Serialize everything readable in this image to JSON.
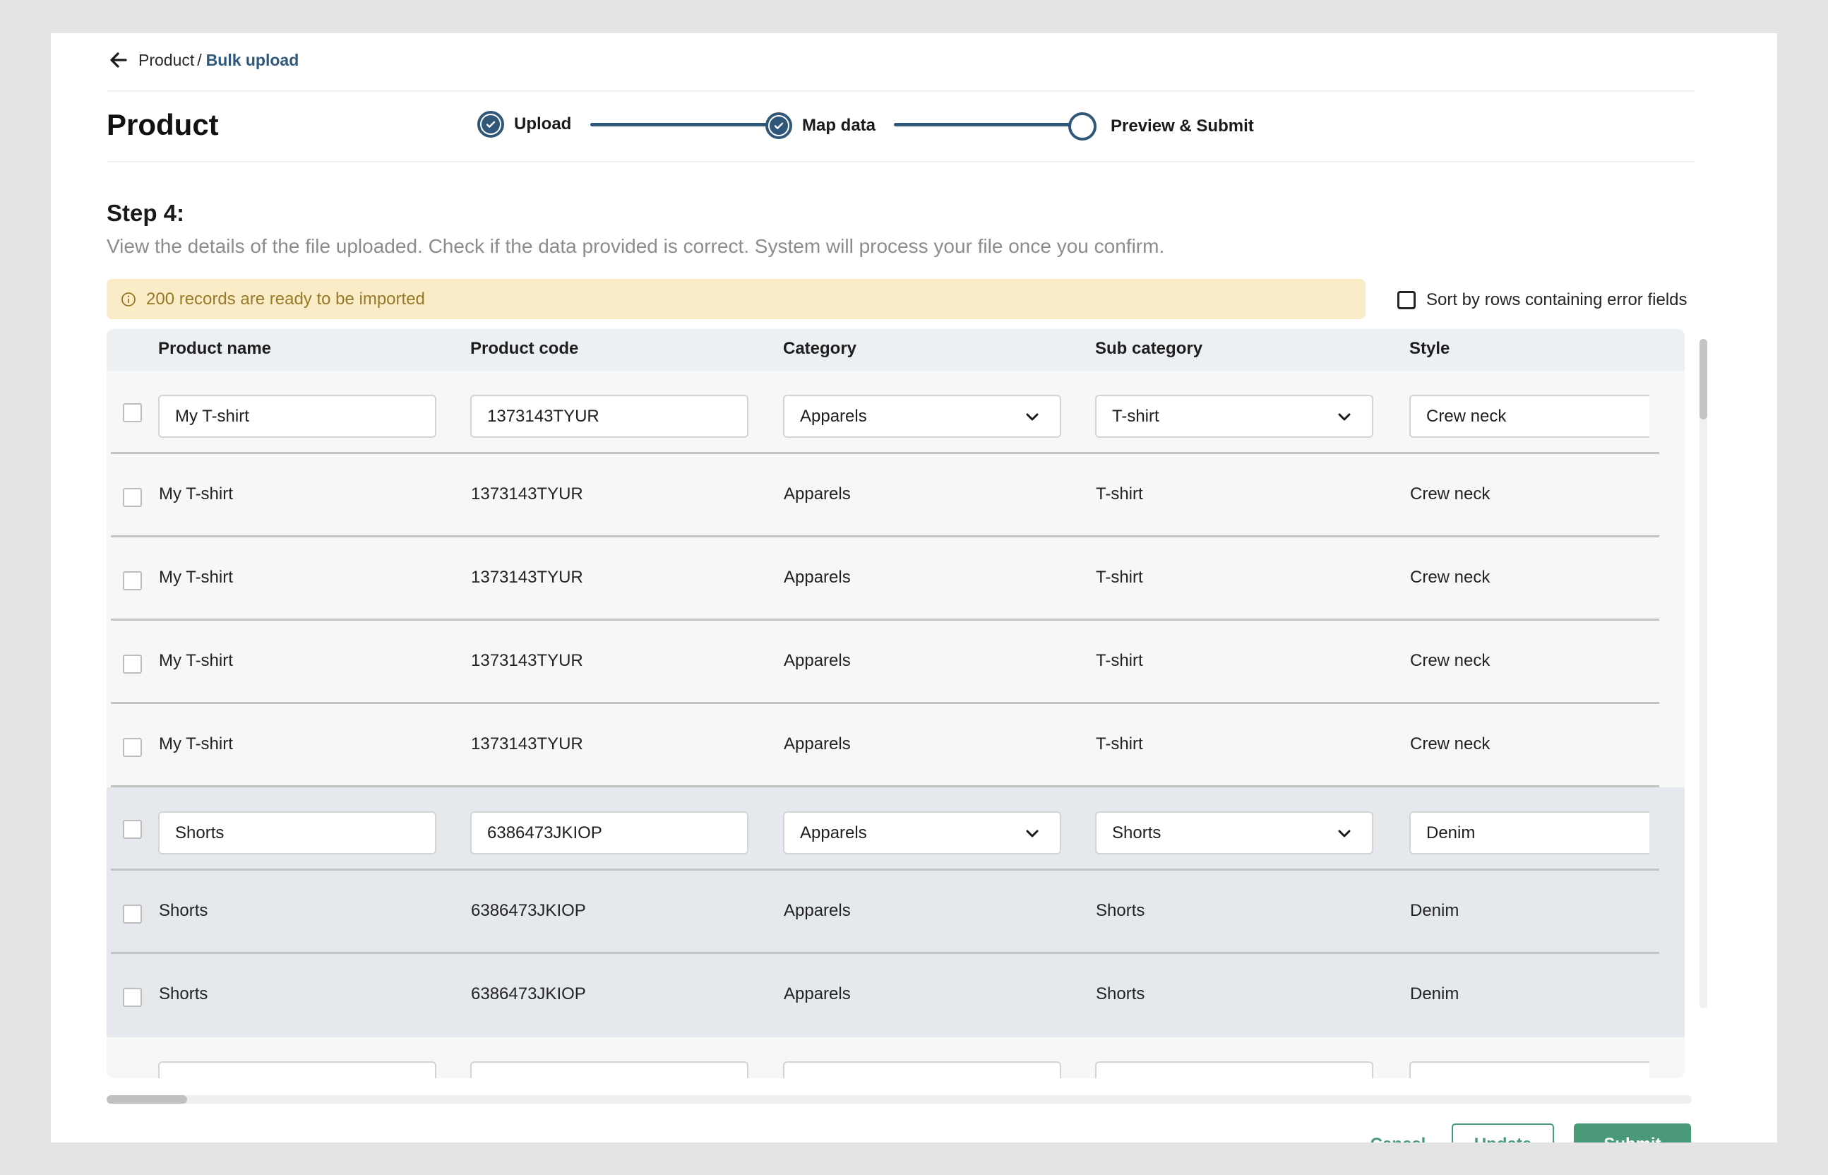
{
  "breadcrumb": {
    "root": "Product",
    "separator": "/",
    "current": "Bulk upload",
    "back_icon": "arrow-left-icon"
  },
  "header": {
    "title": "Product",
    "steps": [
      {
        "label": "Upload",
        "status": "completed"
      },
      {
        "label": "Map data",
        "status": "completed"
      },
      {
        "label": "Preview & Submit",
        "status": "current"
      }
    ]
  },
  "step_info": {
    "heading": "Step 4:",
    "description": "View the details of the file uploaded. Check if the data provided is correct. System will process your file once you confirm."
  },
  "banner": {
    "icon": "info-icon",
    "text": "200 records are ready to be imported",
    "background": "#faecc7",
    "text_color": "#96792a"
  },
  "sort_option": {
    "label": "Sort by rows containing error fields",
    "checked": false
  },
  "table": {
    "columns": [
      "Product name",
      "Product code",
      "Category",
      "Sub category",
      "Style"
    ],
    "rows": [
      {
        "editable": true,
        "group": "tshirt",
        "name": "My T-shirt",
        "code": "1373143TYUR",
        "category": "Apparels",
        "sub_category": "T-shirt",
        "style": "Crew neck"
      },
      {
        "editable": false,
        "group": "tshirt",
        "name": "My T-shirt",
        "code": "1373143TYUR",
        "category": "Apparels",
        "sub_category": "T-shirt",
        "style": "Crew neck"
      },
      {
        "editable": false,
        "group": "tshirt",
        "name": "My T-shirt",
        "code": "1373143TYUR",
        "category": "Apparels",
        "sub_category": "T-shirt",
        "style": "Crew neck"
      },
      {
        "editable": false,
        "group": "tshirt",
        "name": "My T-shirt",
        "code": "1373143TYUR",
        "category": "Apparels",
        "sub_category": "T-shirt",
        "style": "Crew neck"
      },
      {
        "editable": false,
        "group": "tshirt",
        "name": "My T-shirt",
        "code": "1373143TYUR",
        "category": "Apparels",
        "sub_category": "T-shirt",
        "style": "Crew neck"
      },
      {
        "editable": true,
        "group": "shorts",
        "name": "Shorts",
        "code": "6386473JKIOP",
        "category": "Apparels",
        "sub_category": "Shorts",
        "style": "Denim"
      },
      {
        "editable": false,
        "group": "shorts",
        "name": "Shorts",
        "code": "6386473JKIOP",
        "category": "Apparels",
        "sub_category": "Shorts",
        "style": "Denim"
      },
      {
        "editable": false,
        "group": "shorts",
        "name": "Shorts",
        "code": "6386473JKIOP",
        "category": "Apparels",
        "sub_category": "Shorts",
        "style": "Denim"
      },
      {
        "editable": true,
        "group": "next",
        "name": "",
        "code": "",
        "category": "",
        "sub_category": "",
        "style": ""
      }
    ]
  },
  "footer": {
    "cancel_label": "Cancel",
    "update_label": "Update",
    "submit_label": "Submit"
  },
  "colors": {
    "primary": "#2f5779",
    "action": "#4a9a7a",
    "selected_group_bg": "#e5e9ee"
  }
}
